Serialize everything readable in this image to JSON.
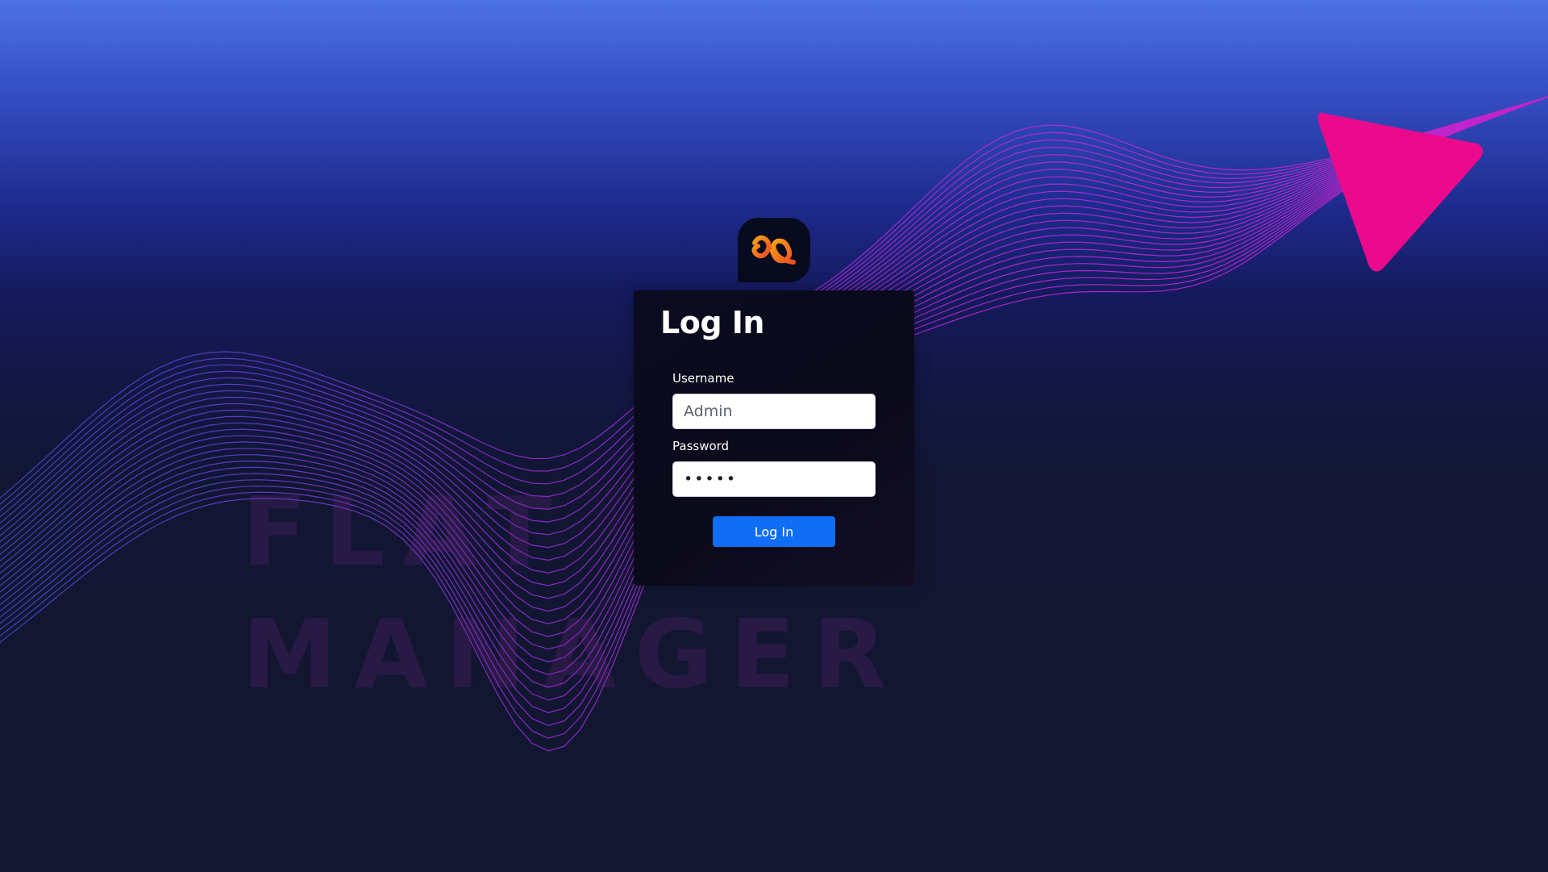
{
  "background": {
    "watermark_line1": "FLAT",
    "watermark_line2": "MANAGER",
    "accent_color": "#ec0a8c"
  },
  "logo": {
    "icon": "app-logo-icon",
    "colors": [
      "#f5a11a",
      "#ef4d24"
    ]
  },
  "login": {
    "title": "Log In",
    "username_label": "Username",
    "username_value": "Admin",
    "password_label": "Password",
    "password_value": "•••••",
    "submit_label": "Log In",
    "submit_color": "#0f6ef5"
  }
}
